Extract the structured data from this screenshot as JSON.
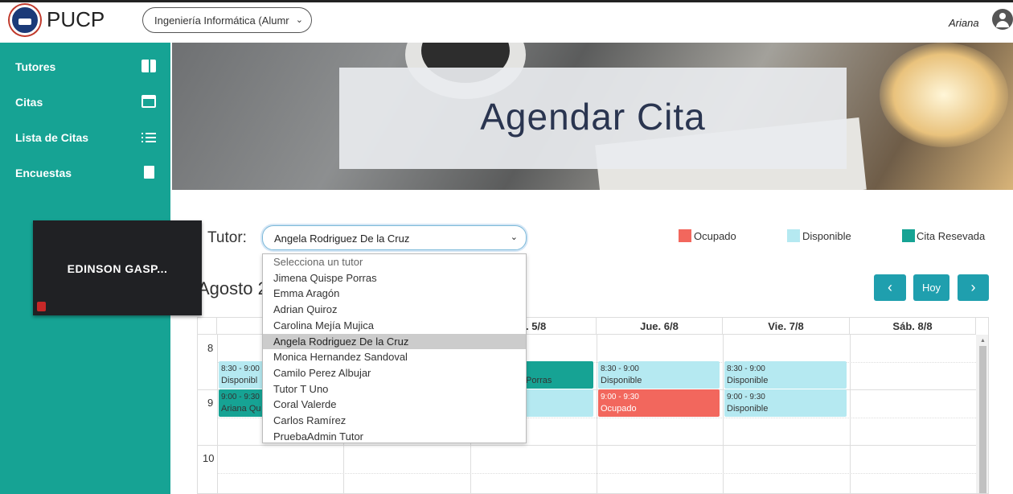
{
  "header": {
    "brand": "PUCP",
    "career_select": "Ingeniería Informática (Alumr",
    "user_name": "Ariana"
  },
  "sidebar": {
    "items": [
      {
        "label": "Tutores",
        "icon": "book-icon"
      },
      {
        "label": "Citas",
        "icon": "calendar-icon"
      },
      {
        "label": "Lista de Citas",
        "icon": "list-icon"
      },
      {
        "label": "Encuestas",
        "icon": "document-icon"
      }
    ]
  },
  "video_overlay": {
    "participant_name": "EDINSON GASP..."
  },
  "banner": {
    "title": "Agendar Cita"
  },
  "tutor": {
    "label": "Tutor:",
    "selected": "Angela Rodriguez De la Cruz",
    "options": [
      "Selecciona un tutor",
      "Jimena Quispe Porras",
      "Emma Aragón",
      "Adrian Quiroz",
      "Carolina Mejía Mujica",
      "Angela Rodriguez De la Cruz",
      "Monica Hernandez Sandoval",
      "Camilo Perez Albujar",
      "Tutor T Uno",
      "Coral Valerde",
      "Carlos Ramírez",
      "PruebaAdmin Tutor"
    ]
  },
  "legend": {
    "items": [
      {
        "label": "Ocupado",
        "color": "#f2675d"
      },
      {
        "label": "Disponible",
        "color": "#b5e9f1"
      },
      {
        "label": "Cita Resevada",
        "color": "#16a394"
      }
    ]
  },
  "calendar": {
    "month": "Agosto 2",
    "today_button": "Hoy",
    "prev_icon": "chevron-left-icon",
    "next_icon": "chevron-right-icon",
    "day_headers": [
      "L",
      "",
      "é. 5/8",
      "Jue. 6/8",
      "Vie. 7/8",
      "Sáb. 8/8"
    ],
    "hours": [
      "8",
      "9",
      "10"
    ],
    "events": {
      "mon_830": {
        "time": "8:30 - 9:00",
        "label": "Disponibl"
      },
      "mon_900": {
        "time": "9:00 - 9:30",
        "label": "Ariana Qu"
      },
      "wed_830": {
        "label": "Porras"
      },
      "thu_830": {
        "time": "8:30 - 9:00",
        "label": "Disponible"
      },
      "thu_900": {
        "time": "9:00 - 9:30",
        "label": "Ocupado"
      },
      "fri_830": {
        "time": "8:30 - 9:00",
        "label": "Disponible"
      },
      "fri_900": {
        "time": "9:00 - 9:30",
        "label": "Disponible"
      }
    }
  }
}
